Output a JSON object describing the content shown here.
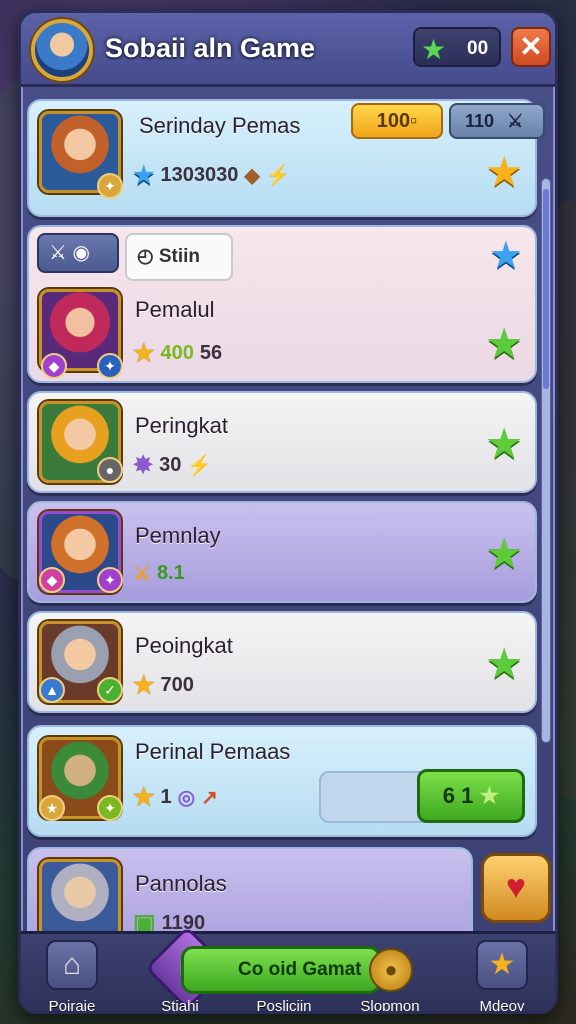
{
  "header": {
    "title": "Sobaii aln Game",
    "gem_value": "00",
    "close_label": "✕"
  },
  "top_card": {
    "name": "Serinday Pemas",
    "pill_primary": "100▫",
    "pill_secondary": "110",
    "stat_value": "1303030"
  },
  "filter_tab": {
    "label": "Stiin"
  },
  "cards": [
    {
      "name": "Pemalul",
      "stat": "400",
      "stat2": "56"
    },
    {
      "name": "Peringkat",
      "stat": "30"
    },
    {
      "name": "Pemnlay",
      "stat": "8.1"
    },
    {
      "name": "Peoingkat",
      "stat": "700"
    },
    {
      "name": "Perinal Pemaas",
      "stat": "1",
      "button_label": "6 1"
    },
    {
      "name": "Pannolas",
      "stat": "1190"
    }
  ],
  "bottom_nav": {
    "items": [
      {
        "label": "Poiraje"
      },
      {
        "label": "Stiahi"
      },
      {
        "label": "Posliciin"
      },
      {
        "label": "Slopmon"
      },
      {
        "label": "Mdeoy"
      }
    ],
    "center_button": "Co oid Gamat"
  },
  "colors": {
    "accent_green": "#5ccc3a",
    "gold": "#f6b21a",
    "panel": "#4a4f8a",
    "close_red": "#d04a20"
  },
  "icons": [
    "gem-icon",
    "close-icon",
    "star-icon",
    "sword-icon",
    "heart-icon",
    "home-icon",
    "coin-icon"
  ]
}
